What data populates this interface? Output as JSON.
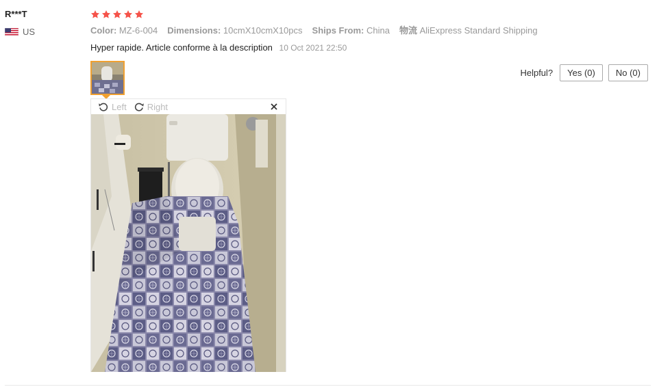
{
  "reviewer": {
    "name": "R***T",
    "country": "US",
    "flag_icon": "us-flag-icon"
  },
  "rating": {
    "stars": 5,
    "max": 5,
    "color": "#f5534a"
  },
  "attributes": [
    {
      "key": "Color:",
      "value": "MZ-6-004"
    },
    {
      "key": "Dimensions:",
      "value": "10cmX10cmX10pcs"
    },
    {
      "key": "Ships From:",
      "value": "China"
    },
    {
      "key": "物流",
      "value": "AliExpress Standard Shipping"
    }
  ],
  "review": {
    "text": "Hyper rapide. Article conforme à la description",
    "date": "10 Oct 2021 22:50"
  },
  "helpful": {
    "label": "Helpful?",
    "yes_label": "Yes (0)",
    "no_label": "No (0)"
  },
  "viewer": {
    "rotate_left_label": "Left",
    "rotate_right_label": "Right",
    "close_icon": "close-icon"
  },
  "colors": {
    "accent": "#f0a030",
    "star": "#f5534a"
  }
}
